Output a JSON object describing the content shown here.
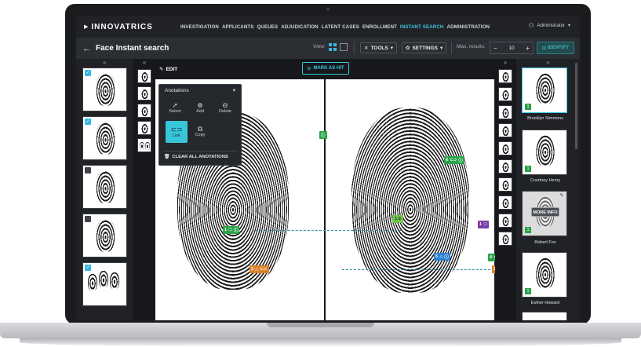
{
  "nav": {
    "logo": "INNOVATRICS",
    "items": [
      "INVESTIGATION",
      "APPLICANTS",
      "QUEUES",
      "ADJUDICATION",
      "LATENT CASES",
      "ENROLLMENT",
      "INSTANT SEARCH",
      "ADMINISTRATION"
    ],
    "active": "INSTANT SEARCH",
    "user": "Administrator"
  },
  "subheader": {
    "back_icon": "arrow-left-icon",
    "title": "Face Instant search",
    "view_label": "View:",
    "tools": "TOOLS",
    "settings": "SETTINGS",
    "max_results_label": "Max. results:",
    "max_results_value": "10",
    "identify": "IDENTIFY"
  },
  "canvas": {
    "edit": "EDIT",
    "mark_as_hit": "MARK AS HIT",
    "score": "1.9"
  },
  "annotations": {
    "title": "Anotations",
    "tools": [
      {
        "label": "Select",
        "icon": "cursor-icon"
      },
      {
        "label": "Add",
        "icon": "plus-circle-icon"
      },
      {
        "label": "Delete",
        "icon": "minus-circle-icon"
      },
      {
        "label": "Link",
        "icon": "link-icon"
      },
      {
        "label": "Copy",
        "icon": "copy-icon"
      }
    ],
    "clear_all": "CLEAR ALL ANOTATIONS"
  },
  "markers": {
    "m1": "1",
    "m2": "2",
    "m3": "3",
    "m4": "4",
    "m5": "5",
    "m6": "6"
  },
  "candidates": [
    {
      "name": "Brooklyn Simmons",
      "rank": "1"
    },
    {
      "name": "Courtney Henry",
      "rank": "1"
    },
    {
      "name": "Robert Fox",
      "rank": "1",
      "more_info": "MORE INFO",
      "index": "#3"
    },
    {
      "name": "Esther Howard",
      "rank": "1"
    }
  ],
  "colors": {
    "accent": "#38c6d9",
    "marker_green": "#2aa34a",
    "marker_orange": "#d9822b",
    "marker_purple": "#7c3aa5",
    "marker_blue": "#2b7fd0"
  }
}
